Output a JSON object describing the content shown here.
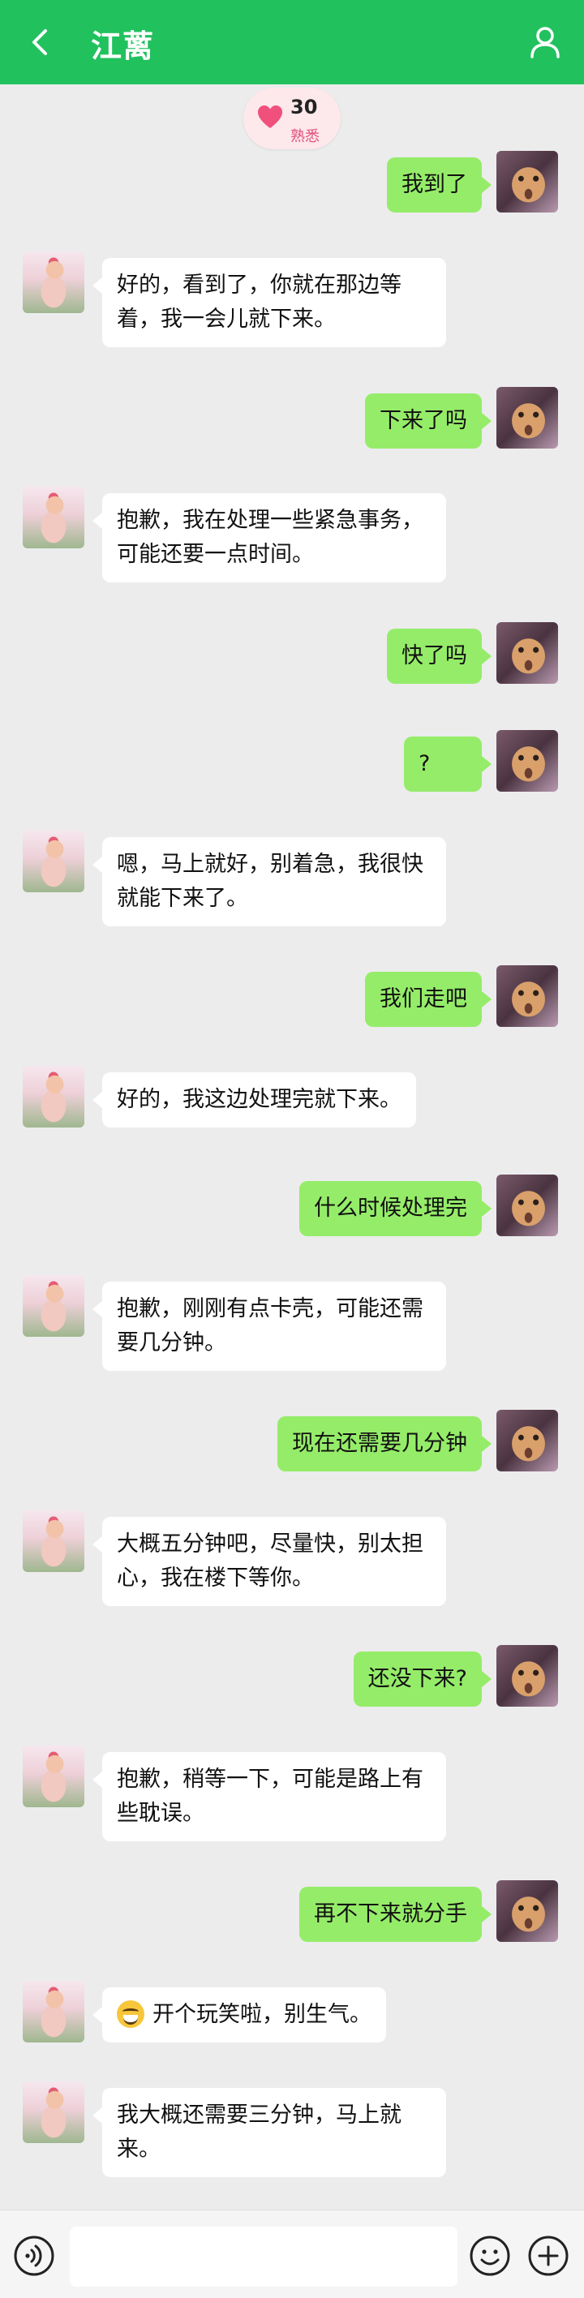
{
  "header": {
    "title": "江蓠"
  },
  "intimacy": {
    "value": "30",
    "label": "熟悉"
  },
  "messages": [
    {
      "from": "me",
      "text": "我到了"
    },
    {
      "from": "other",
      "text": "好的，看到了，你就在那边等着，我一会儿就下来。"
    },
    {
      "from": "me",
      "text": "下来了吗"
    },
    {
      "from": "other",
      "text": "抱歉，我在处理一些紧急事务，可能还要一点时间。"
    },
    {
      "from": "me",
      "text": "快了吗"
    },
    {
      "from": "me",
      "text": "?"
    },
    {
      "from": "other",
      "text": "嗯，马上就好，别着急，我很快就能下来了。"
    },
    {
      "from": "me",
      "text": "我们走吧"
    },
    {
      "from": "other",
      "text": "好的，我这边处理完就下来。"
    },
    {
      "from": "me",
      "text": "什么时候处理完"
    },
    {
      "from": "other",
      "text": "抱歉，刚刚有点卡壳，可能还需要几分钟。"
    },
    {
      "from": "me",
      "text": "现在还需要几分钟"
    },
    {
      "from": "other",
      "text": "大概五分钟吧，尽量快，别太担心，我在楼下等你。"
    },
    {
      "from": "me",
      "text": "还没下来?"
    },
    {
      "from": "other",
      "text": "抱歉，稍等一下，可能是路上有些耽误。"
    },
    {
      "from": "me",
      "text": "再不下来就分手"
    },
    {
      "from": "other",
      "text": "开个玩笑啦，别生气。",
      "emoji": "grinning-sweat-emoji"
    },
    {
      "from": "other",
      "text": "我大概还需要三分钟，马上就来。"
    }
  ],
  "input": {
    "placeholder": ""
  },
  "icons": {
    "back": "chevron-left-icon",
    "profile": "person-icon",
    "intimacy": "heart-icon",
    "voice": "voice-icon",
    "emoji": "smiley-icon",
    "more": "plus-icon"
  },
  "colors": {
    "header": "#21c15e",
    "my_bubble": "#95ec69",
    "other_bubble": "#ffffff",
    "background": "#ececec",
    "heart": "#f0507c"
  }
}
